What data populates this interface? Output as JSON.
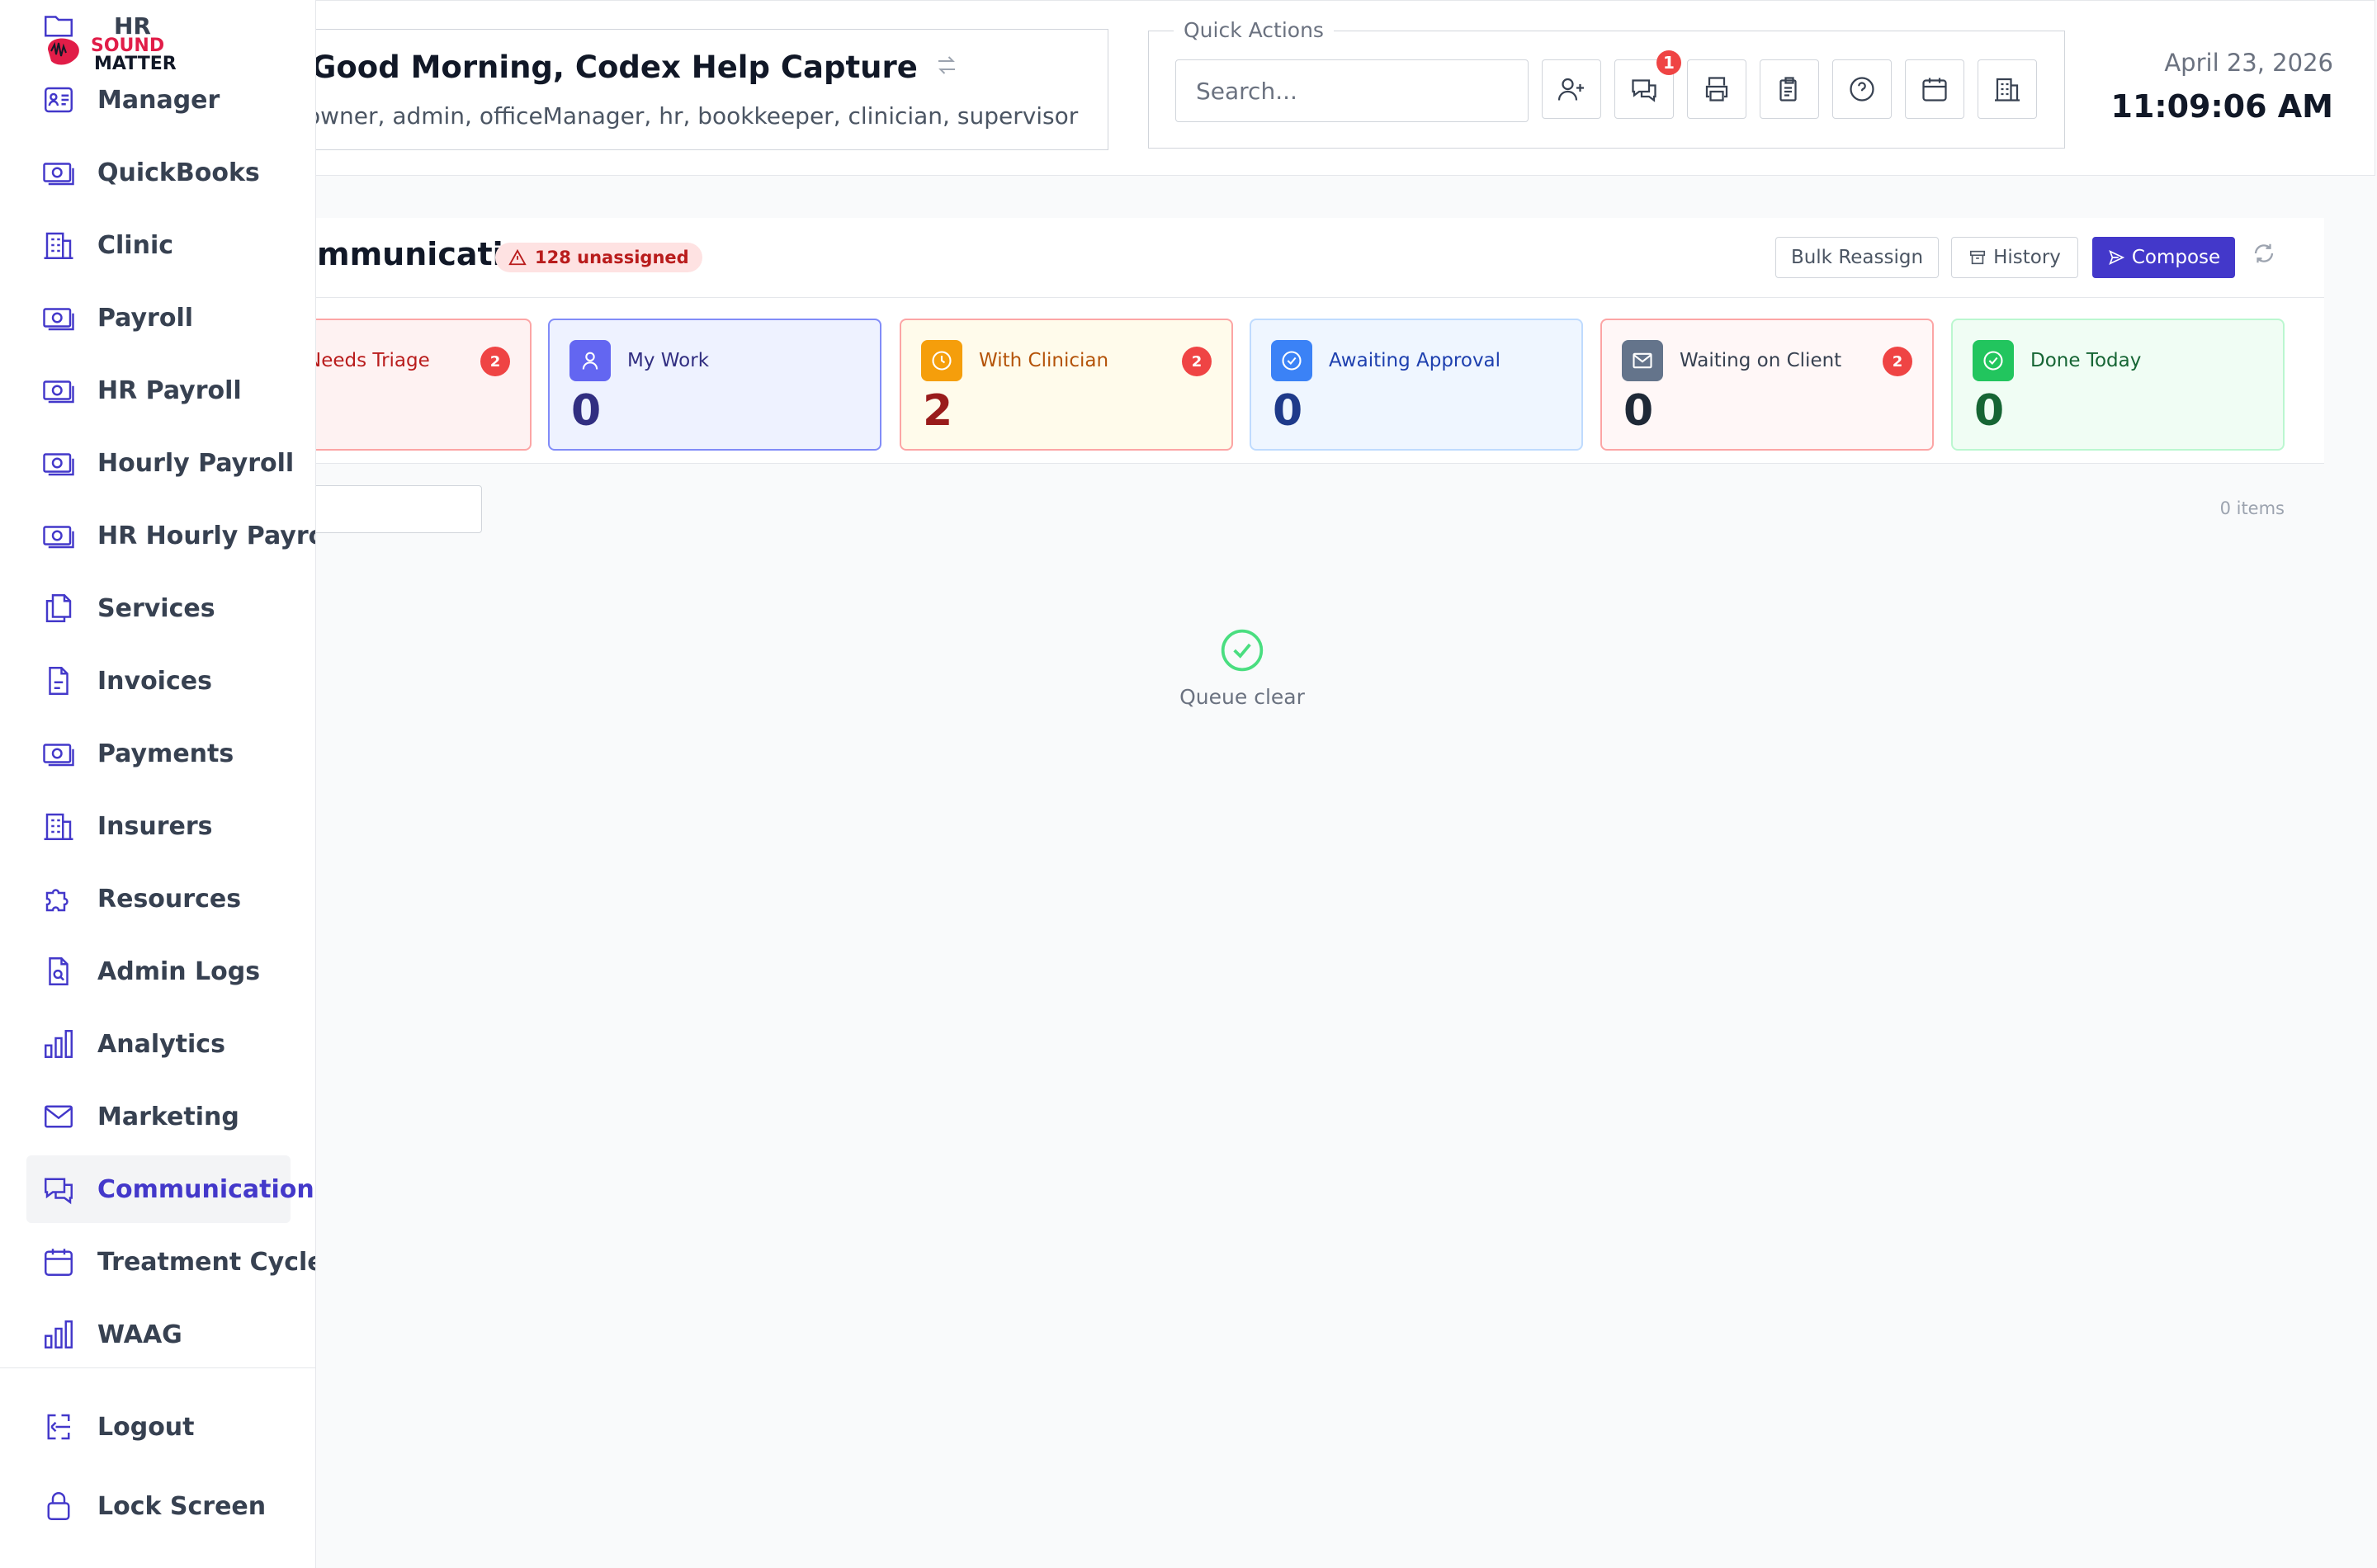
{
  "header": {
    "greeting": "Good Morning, Codex Help Capture",
    "roles": "owner, admin, officeManager, hr, bookkeeper, clinician, supervisor",
    "quick_actions_label": "Quick Actions",
    "search_placeholder": "Search...",
    "messages_badge": "1",
    "date": "April 23, 2026",
    "time": "11:09:06 AM"
  },
  "sidebar": {
    "logo": {
      "line1": "SOUND",
      "line2": "MATTERS"
    },
    "items": [
      {
        "label": "HR",
        "icon": "folder-icon"
      },
      {
        "label": "Manager",
        "icon": "id-card-icon"
      },
      {
        "label": "QuickBooks",
        "icon": "money-icon"
      },
      {
        "label": "Clinic",
        "icon": "building-icon"
      },
      {
        "label": "Payroll",
        "icon": "money-icon"
      },
      {
        "label": "HR Payroll",
        "icon": "money-icon"
      },
      {
        "label": "Hourly Payroll",
        "icon": "money-icon"
      },
      {
        "label": "HR Hourly Payroll",
        "icon": "money-icon"
      },
      {
        "label": "Services",
        "icon": "files-icon"
      },
      {
        "label": "Invoices",
        "icon": "document-icon"
      },
      {
        "label": "Payments",
        "icon": "money-icon"
      },
      {
        "label": "Insurers",
        "icon": "building-icon"
      },
      {
        "label": "Resources",
        "icon": "puzzle-icon"
      },
      {
        "label": "Admin Logs",
        "icon": "file-search-icon"
      },
      {
        "label": "Analytics",
        "icon": "bar-chart-icon"
      },
      {
        "label": "Marketing",
        "icon": "mail-icon"
      },
      {
        "label": "Communications",
        "icon": "chat-icon"
      },
      {
        "label": "Treatment Cycles",
        "icon": "calendar-icon"
      },
      {
        "label": "WAAG",
        "icon": "bar-chart-icon"
      }
    ],
    "active": "Communications",
    "logout": "Logout",
    "lock": "Lock Screen"
  },
  "main": {
    "title": "Communications",
    "unassigned": "128 unassigned",
    "bulk_reassign": "Bulk Reassign",
    "history": "History",
    "compose": "Compose",
    "items_count": "0 items",
    "empty_text": "Queue clear"
  },
  "cards": [
    {
      "label": "Needs Triage",
      "count": "",
      "badge": "2",
      "color": "#b91c1c"
    },
    {
      "label": "My Work",
      "count": "0",
      "badge": "",
      "color": "#312e81"
    },
    {
      "label": "With Clinician",
      "count": "2",
      "badge": "2",
      "color": "#991b1b"
    },
    {
      "label": "Awaiting Approval",
      "count": "0",
      "badge": "",
      "color": "#1e3a8a"
    },
    {
      "label": "Waiting on Client",
      "count": "0",
      "badge": "2",
      "color": "#1f2937"
    },
    {
      "label": "Done Today",
      "count": "0",
      "badge": "",
      "color": "#166534"
    }
  ],
  "colors": {
    "accent": "#4338ca",
    "danger": "#ef4444",
    "success": "#22c55e"
  }
}
